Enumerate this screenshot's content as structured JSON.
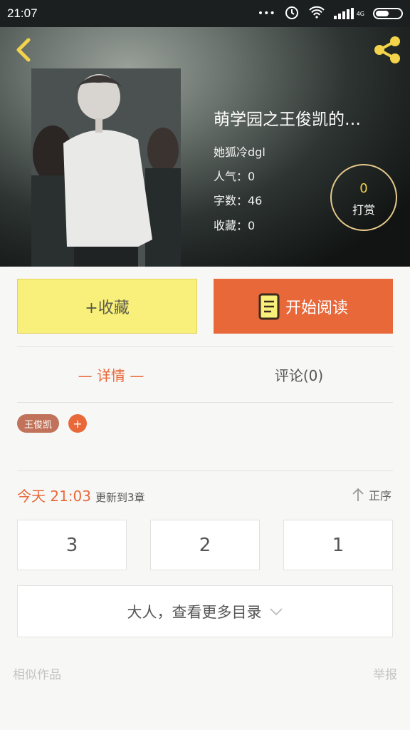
{
  "status_bar": {
    "time": "21:07",
    "signal_label": "4G",
    "icons": [
      "dots-icon",
      "alarm-icon",
      "wifi-icon",
      "signal-icon",
      "battery-icon"
    ]
  },
  "header": {
    "back_icon": "chevron-left-icon",
    "share_icon": "share-icon",
    "accent_color": "#f2d34a"
  },
  "book": {
    "title": "萌学园之王俊凯的…",
    "author": "她狐冷dgl",
    "popularity": "人气：0",
    "word_count": "字数：46",
    "favorites": "收藏：0",
    "tip_count": "0",
    "tip_label": "打赏"
  },
  "actions": {
    "collect_label": "+收藏",
    "read_label": "开始阅读",
    "read_color": "#e9683a",
    "collect_color": "#f8f07a"
  },
  "tabs": {
    "details": "— 详情 —",
    "comments": "评论(0)"
  },
  "tags": {
    "items": [
      "王俊凯"
    ],
    "add_label": "+"
  },
  "updates": {
    "time": "今天 21:03",
    "text": "更新到3章",
    "sort_label": "正序"
  },
  "chapters": [
    "3",
    "2",
    "1"
  ],
  "toc": {
    "more_label": "大人，查看更多目录"
  },
  "footer": {
    "similar_label": "相似作品",
    "report_label": "举报"
  }
}
